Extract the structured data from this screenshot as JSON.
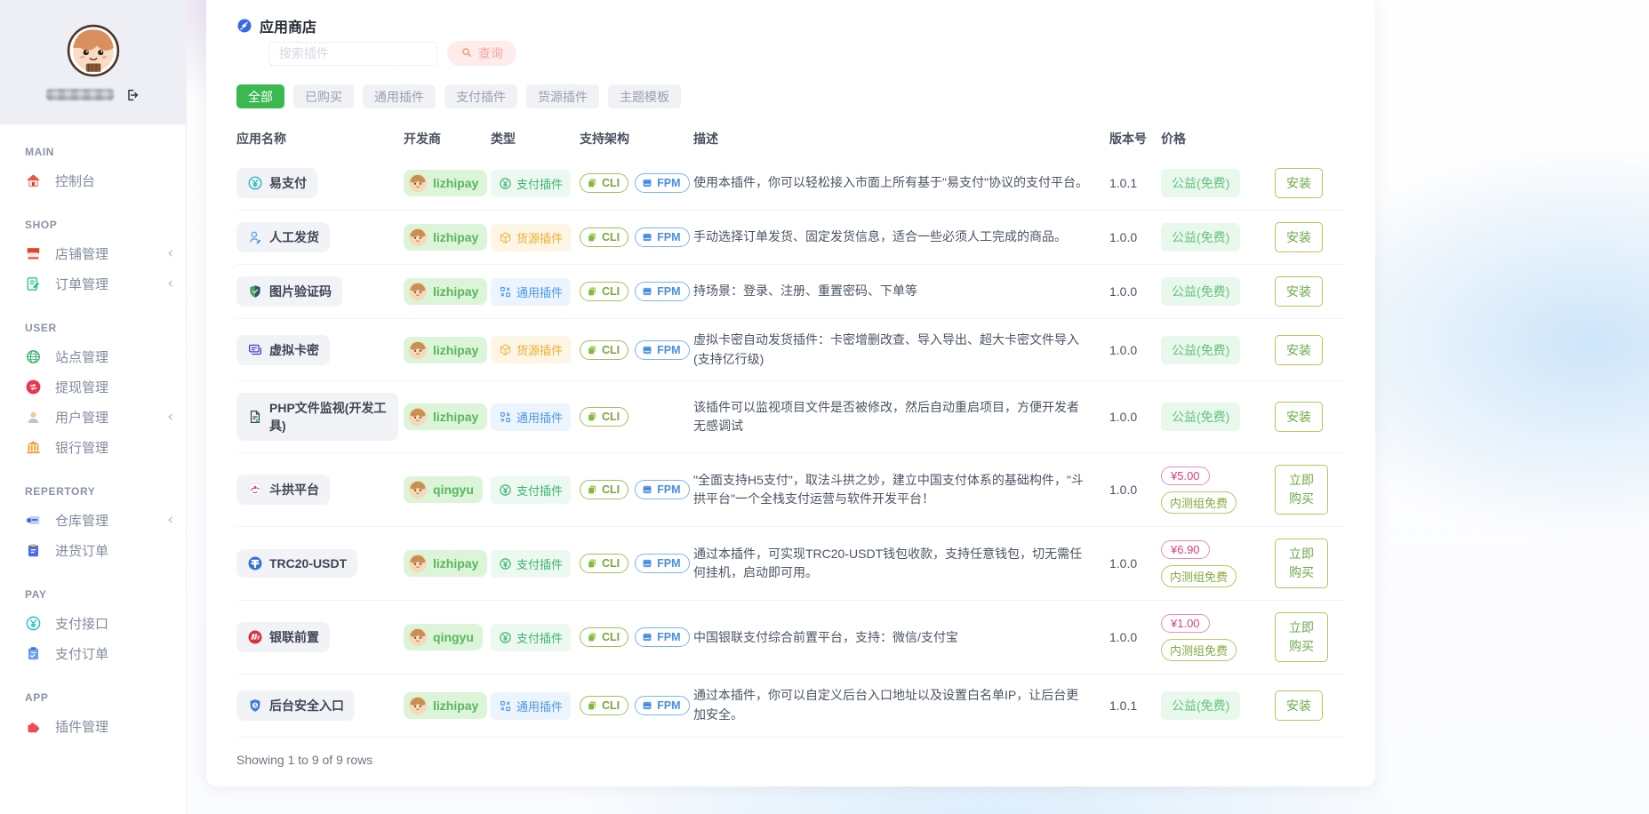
{
  "colors": {
    "accent_green": "#3bb950",
    "type_pay_text": "#3cb371",
    "type_source_text": "#f0ad2e",
    "type_general_text": "#4a97ea",
    "price_pink": "#dd3d7e",
    "install_green": "#6cab47",
    "query_btn_bg": "#fdeceb"
  },
  "sidebar": {
    "sections": [
      {
        "label": "MAIN",
        "items": [
          {
            "id": "console",
            "label": "控制台",
            "icon": "house-icon"
          }
        ]
      },
      {
        "label": "SHOP",
        "items": [
          {
            "id": "shop-manage",
            "label": "店铺管理",
            "icon": "store-icon",
            "expandable": true
          },
          {
            "id": "order-manage",
            "label": "订单管理",
            "icon": "order-icon",
            "expandable": true
          }
        ]
      },
      {
        "label": "USER",
        "items": [
          {
            "id": "site-manage",
            "label": "站点管理",
            "icon": "globe-icon"
          },
          {
            "id": "withdraw-manage",
            "label": "提现管理",
            "icon": "withdraw-icon"
          },
          {
            "id": "user-manage",
            "label": "用户管理",
            "icon": "user-icon",
            "expandable": true
          },
          {
            "id": "bank-manage",
            "label": "银行管理",
            "icon": "bank-icon"
          }
        ]
      },
      {
        "label": "REPERTORY",
        "items": [
          {
            "id": "warehouse-manage",
            "label": "仓库管理",
            "icon": "warehouse-icon",
            "expandable": true
          },
          {
            "id": "purchase-order",
            "label": "进货订单",
            "icon": "clipboard-icon"
          }
        ]
      },
      {
        "label": "PAY",
        "items": [
          {
            "id": "pay-api",
            "label": "支付接口",
            "icon": "yen-circle-icon"
          },
          {
            "id": "pay-order",
            "label": "支付订单",
            "icon": "pay-order-icon"
          }
        ]
      },
      {
        "label": "APP",
        "items": [
          {
            "id": "plugin-manage",
            "label": "插件管理",
            "icon": "puzzle-icon"
          }
        ]
      }
    ]
  },
  "header": {
    "title": "应用商店",
    "search_placeholder": "搜索插件",
    "query_label": "查询"
  },
  "tabs": [
    {
      "label": "全部",
      "active": true
    },
    {
      "label": "已购买",
      "active": false
    },
    {
      "label": "通用插件",
      "active": false
    },
    {
      "label": "支付插件",
      "active": false
    },
    {
      "label": "货源插件",
      "active": false
    },
    {
      "label": "主题模板",
      "active": false
    }
  ],
  "table": {
    "headers": [
      "应用名称",
      "开发商",
      "类型",
      "支持架构",
      "描述",
      "版本号",
      "价格",
      ""
    ],
    "rows": [
      {
        "name": "易支付",
        "app_icon": "yen-teal-icon",
        "developer": "lizhipay",
        "type": {
          "label": "支付插件",
          "variant": "pay",
          "icon": "yen-green-icon"
        },
        "arch": [
          "CLI",
          "FPM"
        ],
        "desc": "使用本插件，你可以轻松接入市面上所有基于\"易支付\"协议的支付平台。",
        "version": "1.0.1",
        "price": {
          "free": true,
          "label": "公益(免费)"
        },
        "action": "安装"
      },
      {
        "name": "人工发货",
        "app_icon": "person-icon",
        "developer": "lizhipay",
        "type": {
          "label": "货源插件",
          "variant": "source",
          "icon": "cube-icon"
        },
        "arch": [
          "CLI",
          "FPM"
        ],
        "desc": "手动选择订单发货、固定发货信息，适合一些必须人工完成的商品。",
        "version": "1.0.0",
        "price": {
          "free": true,
          "label": "公益(免费)"
        },
        "action": "安装"
      },
      {
        "name": "图片验证码",
        "app_icon": "shield-check-icon",
        "developer": "lizhipay",
        "type": {
          "label": "通用插件",
          "variant": "general",
          "icon": "general-plugin-icon"
        },
        "arch": [
          "CLI",
          "FPM"
        ],
        "desc": "持场景：登录、注册、重置密码、下单等",
        "version": "1.0.0",
        "price": {
          "free": true,
          "label": "公益(免费)"
        },
        "action": "安装"
      },
      {
        "name": "虚拟卡密",
        "app_icon": "cards-icon",
        "developer": "lizhipay",
        "type": {
          "label": "货源插件",
          "variant": "source",
          "icon": "cube-icon"
        },
        "arch": [
          "CLI",
          "FPM"
        ],
        "desc": "虚拟卡密自动发货插件：卡密增删改查、导入导出、超大卡密文件导入(支持亿行级)",
        "version": "1.0.0",
        "price": {
          "free": true,
          "label": "公益(免费)"
        },
        "action": "安装"
      },
      {
        "name": "PHP文件监视(开发工具)",
        "app_icon": "file-monitor-icon",
        "developer": "lizhipay",
        "type": {
          "label": "通用插件",
          "variant": "general",
          "icon": "general-plugin-icon"
        },
        "arch": [
          "CLI"
        ],
        "desc": "该插件可以监视项目文件是否被修改，然后自动重启项目，方便开发者无感调试",
        "version": "1.0.0",
        "price": {
          "free": true,
          "label": "公益(免费)"
        },
        "action": "安装"
      },
      {
        "name": "斗拱平台",
        "app_icon": "dougong-icon",
        "developer": "qingyu",
        "type": {
          "label": "支付插件",
          "variant": "pay",
          "icon": "yen-green-icon"
        },
        "arch": [
          "CLI",
          "FPM"
        ],
        "desc": "\"全面支持H5支付\"，取法斗拱之妙，建立中国支付体系的基础构件，\"斗拱平台\"一个全栈支付运营与软件开发平台！",
        "version": "1.0.0",
        "price": {
          "free": false,
          "amount": "¥5.00",
          "note": "内测组免费"
        },
        "action": "立即购买"
      },
      {
        "name": "TRC20-USDT",
        "app_icon": "tether-icon",
        "developer": "lizhipay",
        "type": {
          "label": "支付插件",
          "variant": "pay",
          "icon": "yen-green-icon"
        },
        "arch": [
          "CLI",
          "FPM"
        ],
        "desc": "通过本插件，可实现TRC20-USDT钱包收款，支持任意钱包，切无需任何挂机，启动即可用。",
        "version": "1.0.0",
        "price": {
          "free": false,
          "amount": "¥6.90",
          "note": "内测组免费"
        },
        "action": "立即购买"
      },
      {
        "name": "银联前置",
        "app_icon": "unionpay-icon",
        "developer": "qingyu",
        "type": {
          "label": "支付插件",
          "variant": "pay",
          "icon": "yen-green-icon"
        },
        "arch": [
          "CLI",
          "FPM"
        ],
        "desc": "中国银联支付综合前置平台，支持：微信/支付宝",
        "version": "1.0.0",
        "price": {
          "free": false,
          "amount": "¥1.00",
          "note": "内测组免费"
        },
        "action": "立即购买"
      },
      {
        "name": "后台安全入口",
        "app_icon": "shield-lock-icon",
        "developer": "lizhipay",
        "type": {
          "label": "通用插件",
          "variant": "general",
          "icon": "general-plugin-icon"
        },
        "arch": [
          "CLI",
          "FPM"
        ],
        "desc": "通过本插件，你可以自定义后台入口地址以及设置白名单IP，让后台更加安全。",
        "version": "1.0.1",
        "price": {
          "free": true,
          "label": "公益(免费)"
        },
        "action": "安装"
      }
    ]
  },
  "footer": {
    "showing": "Showing 1 to 9 of 9 rows"
  }
}
